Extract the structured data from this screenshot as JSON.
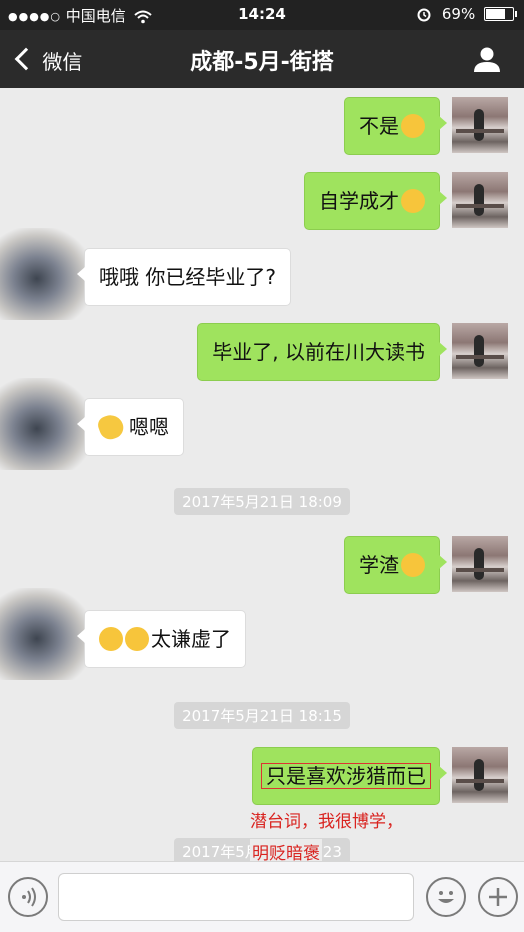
{
  "status_bar": {
    "carrier": "中国电信",
    "time": "14:24",
    "battery": "69%"
  },
  "nav": {
    "back_label": "微信",
    "title": "成都-5月-街搭"
  },
  "messages": [
    {
      "side": "me",
      "text": "不是"
    },
    {
      "side": "me",
      "text": "自学成才"
    },
    {
      "side": "them",
      "text": "哦哦 你已经毕业了?"
    },
    {
      "side": "me",
      "text": "毕业了, 以前在川大读书"
    },
    {
      "side": "them",
      "text": "嗯嗯"
    },
    {
      "side": "me",
      "text": "学渣"
    },
    {
      "side": "them",
      "text": "太谦虚了"
    },
    {
      "side": "me",
      "text": "只是喜欢涉猎而已"
    }
  ],
  "timestamps": [
    "2017年5月21日 18:09",
    "2017年5月21日 18:15",
    "2017年5月21日 18:23"
  ],
  "annotation": {
    "line1": "潜台词，我很博学，",
    "line2": "明贬暗褒"
  },
  "icons": [
    "wifi-icon",
    "alarm-icon",
    "battery-icon",
    "back-chevron-icon",
    "person-icon",
    "voice-icon",
    "emoji-icon",
    "plus-icon"
  ]
}
